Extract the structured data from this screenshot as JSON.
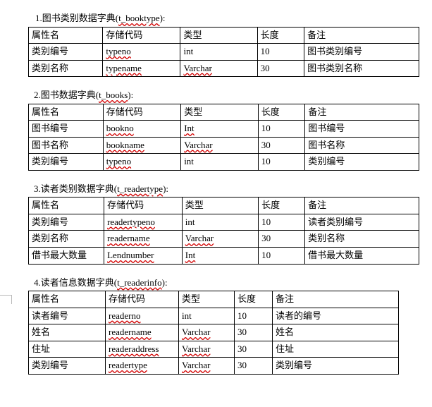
{
  "sections": [
    {
      "title_prefix": "1.图书类别数据字典(",
      "title_code": "t_booktype",
      "title_suffix": "):",
      "spell_title": true,
      "t4": false,
      "header": [
        "属性名",
        "存储代码",
        "类型",
        "长度",
        "备注"
      ],
      "rows": [
        {
          "attr": "类别编号",
          "code": "typeno",
          "type": "int",
          "type_sp": false,
          "len": "10",
          "note": "图书类别编号"
        },
        {
          "attr": "类别名称",
          "code": "typename",
          "type": "Varchar",
          "type_sp": true,
          "len": "30",
          "note": "图书类别名称"
        }
      ]
    },
    {
      "title_prefix": "2.图书数据字典(",
      "title_code": "t_books",
      "title_suffix": "):",
      "spell_title": true,
      "t4": false,
      "header": [
        "属性名",
        "存储代码",
        "类型",
        "长度",
        "备注"
      ],
      "rows": [
        {
          "attr": "图书编号",
          "code": "bookno",
          "type": "Int",
          "type_sp": true,
          "len": "10",
          "note": "图书编号"
        },
        {
          "attr": "图书名称",
          "code": "bookname",
          "type": "Varchar",
          "type_sp": true,
          "len": "30",
          "note": "图书名称"
        },
        {
          "attr": "类别编号",
          "code": "typeno",
          "type": "int",
          "type_sp": false,
          "len": "10",
          "note": "类别编号"
        }
      ]
    },
    {
      "title_prefix": "3.读者类别数据字典(",
      "title_code": "t_readertype",
      "title_suffix": "):",
      "spell_title": true,
      "t4": false,
      "header": [
        "属性名",
        "存储代码",
        "类型",
        "长度",
        "备注"
      ],
      "rows": [
        {
          "attr": "类别编号",
          "code": "readertypeno",
          "type": "int",
          "type_sp": false,
          "len": "10",
          "note": "读者类别编号"
        },
        {
          "attr": "类别名称",
          "code": "readername",
          "type": "Varchar",
          "type_sp": true,
          "len": "30",
          "note": "类别名称"
        },
        {
          "attr": "借书最大数量",
          "code": "Lendnumber",
          "type": "Int",
          "type_sp": true,
          "len": "10",
          "note": "借书最大数量"
        }
      ]
    },
    {
      "title_prefix": "4.读者信息数据字典(",
      "title_code": "t_readerinfo",
      "title_suffix": "):",
      "spell_title": true,
      "t4": true,
      "header": [
        "属性名",
        "存储代码",
        "类型",
        "长度",
        "备注"
      ],
      "rows": [
        {
          "attr": "读者编号",
          "code": "readerno",
          "type": "int",
          "type_sp": false,
          "len": "10",
          "note": "读者的编号"
        },
        {
          "attr": "姓名",
          "code": "readername",
          "type": "Varchar",
          "type_sp": true,
          "len": "30",
          "note": "姓名"
        },
        {
          "attr": "住址",
          "code": "readeraddress",
          "type": "Varchar",
          "type_sp": true,
          "len": "30",
          "note": "住址"
        },
        {
          "attr": "类别编号",
          "code": "readertype",
          "type": "Varchar",
          "type_sp": true,
          "len": "30",
          "note": "类别编号"
        }
      ]
    }
  ]
}
